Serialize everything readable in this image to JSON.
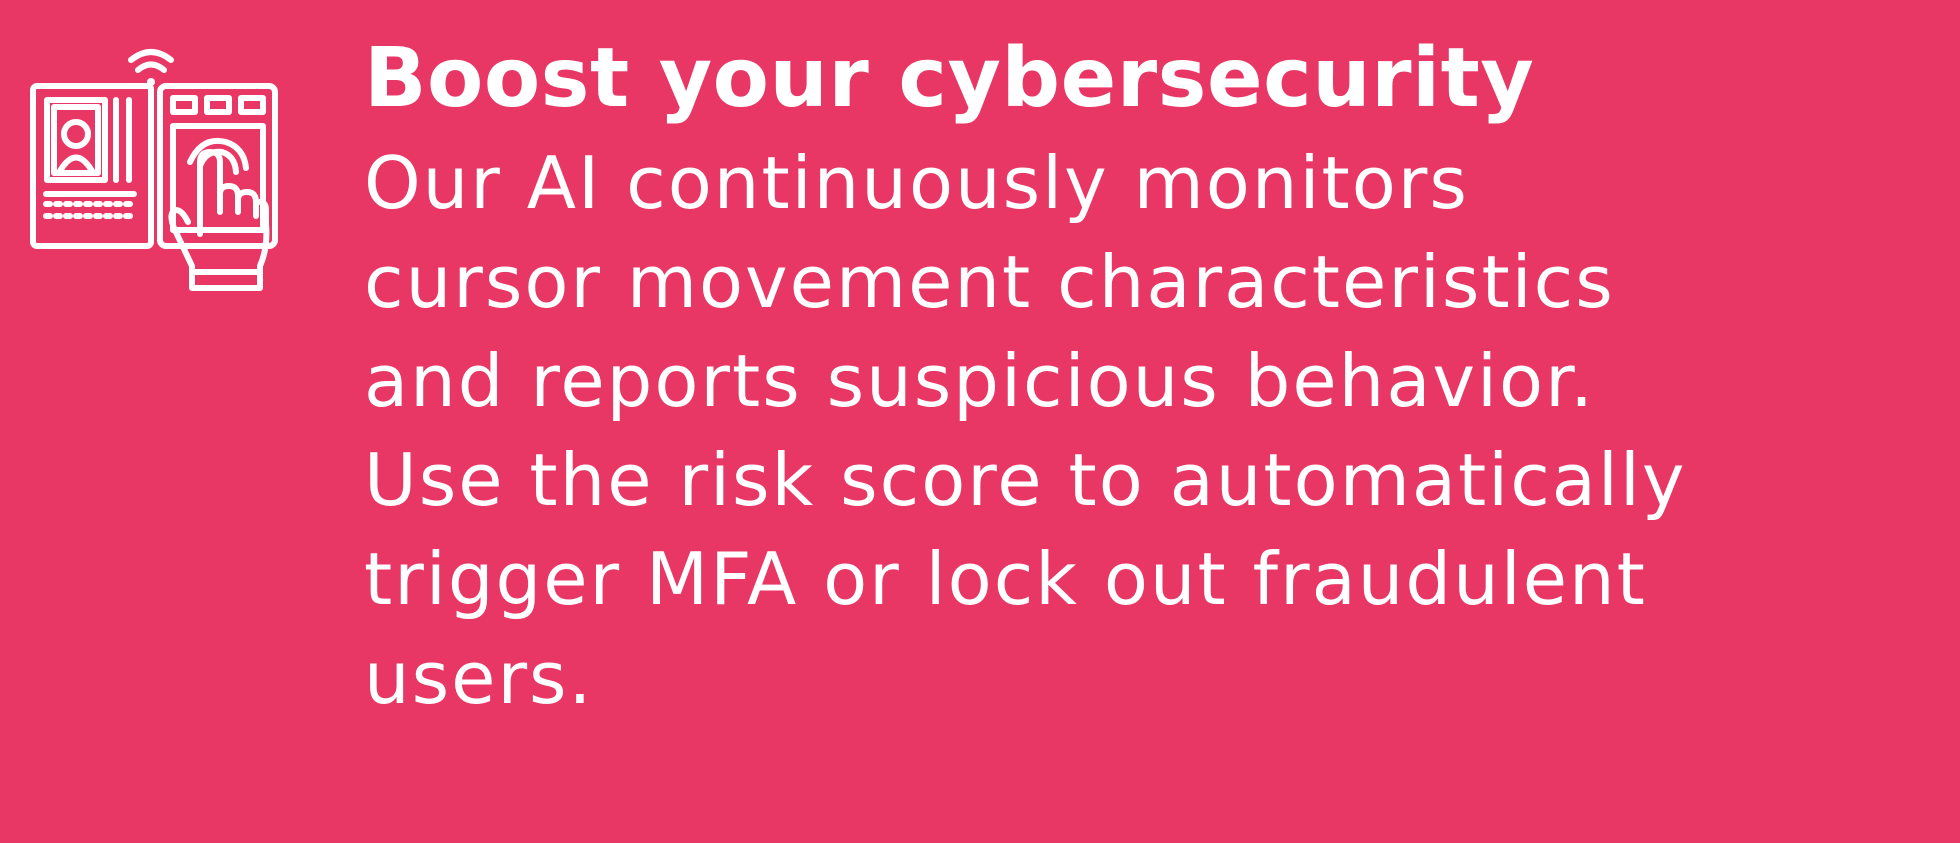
{
  "colors": {
    "background": "#E93765",
    "foreground": "#FFFFFF"
  },
  "icon": {
    "name": "biometric-access-terminal-icon"
  },
  "heading": "Boost your cybersecurity",
  "body_lines": [
    "Our AI continuously monitors",
    "cursor movement characteristics",
    "and reports suspicious behavior.",
    "Use the risk score to automatically",
    "trigger MFA or lock out fraudulent",
    "users."
  ]
}
